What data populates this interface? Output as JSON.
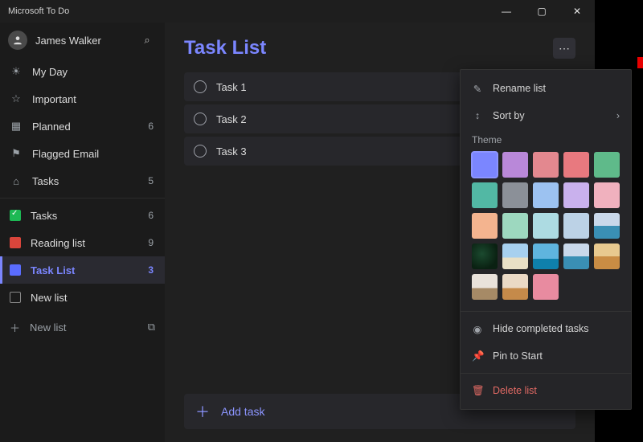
{
  "app_title": "Microsoft To Do",
  "user": {
    "name": "James Walker"
  },
  "sidebar": {
    "smart": [
      {
        "icon": "☀",
        "label": "My Day",
        "count": ""
      },
      {
        "icon": "☆",
        "label": "Important",
        "count": ""
      },
      {
        "icon": "▦",
        "label": "Planned",
        "count": "6"
      },
      {
        "icon": "⚑",
        "label": "Flagged Email",
        "count": ""
      },
      {
        "icon": "⌂",
        "label": "Tasks",
        "count": "5"
      }
    ],
    "lists": [
      {
        "color": "green-check",
        "label": "Tasks",
        "count": "6"
      },
      {
        "color": "red",
        "label": "Reading list",
        "count": "9"
      },
      {
        "color": "blue",
        "label": "Task List",
        "count": "3",
        "selected": true
      },
      {
        "color": "outline",
        "label": "New list",
        "count": ""
      }
    ],
    "new_list_label": "New list"
  },
  "main": {
    "title": "Task List",
    "tasks": [
      {
        "title": "Task 1"
      },
      {
        "title": "Task 2"
      },
      {
        "title": "Task 3"
      }
    ],
    "add_task_label": "Add task"
  },
  "menu": {
    "rename": "Rename list",
    "sort": "Sort by",
    "theme_heading": "Theme",
    "hide_completed": "Hide completed tasks",
    "pin": "Pin to Start",
    "delete": "Delete list",
    "swatches": [
      {
        "color": "#7b86ff",
        "selected": true
      },
      {
        "color": "#b988d9"
      },
      {
        "color": "#e3888f"
      },
      {
        "color": "#e8797f"
      },
      {
        "color": "#5fba8a"
      },
      {
        "color": "#52b8a4"
      },
      {
        "color": "#8b9098"
      },
      {
        "color": "#9cc2f1"
      },
      {
        "color": "#c9b1ed"
      },
      {
        "color": "#f0b1be"
      },
      {
        "color": "#f4b48f"
      },
      {
        "color": "#9dd8bf"
      },
      {
        "color": "#addbe2"
      },
      {
        "color": "#bcd2e6"
      },
      {
        "thumb": "thumb-island"
      },
      {
        "thumb": "thumb-forest"
      },
      {
        "thumb": "thumb-sky"
      },
      {
        "thumb": "thumb-sea"
      },
      {
        "thumb": "thumb-island"
      },
      {
        "thumb": "thumb-sunset"
      },
      {
        "thumb": "thumb-light"
      },
      {
        "thumb": "thumb-kite"
      },
      {
        "color": "#e88ba0"
      }
    ]
  }
}
